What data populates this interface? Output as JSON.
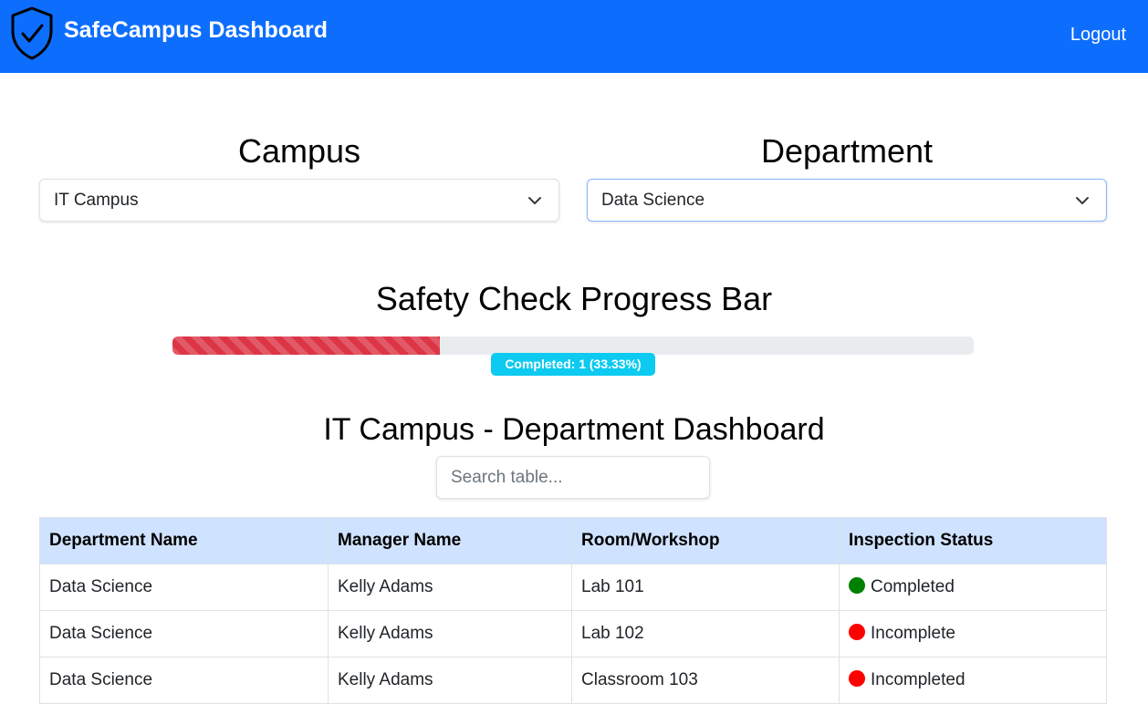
{
  "navbar": {
    "brand_title": "SafeCampus Dashboard",
    "logout_label": "Logout",
    "brand_icon": "shield-check-icon",
    "color": "#0d6efd"
  },
  "filters": {
    "campus_label": "Campus",
    "campus_value": "IT Campus",
    "department_label": "Department",
    "department_value": "Data Science"
  },
  "progress": {
    "title": "Safety Check Progress Bar",
    "completed_fraction": 0.3333,
    "badge_text": "Completed: 1 (33.33%)",
    "fill_color": "#dc3545",
    "badge_color": "#0dcaf0"
  },
  "dashboard": {
    "title": "IT Campus - Department Dashboard",
    "search_placeholder": "Search table..."
  },
  "table": {
    "headers": [
      "Department Name",
      "Manager Name",
      "Room/Workshop",
      "Inspection Status"
    ],
    "rows": [
      {
        "department": "Data Science",
        "manager": "Kelly Adams",
        "room": "Lab 101",
        "status": "Completed",
        "status_color": "#008000"
      },
      {
        "department": "Data Science",
        "manager": "Kelly Adams",
        "room": "Lab 102",
        "status": "Incomplete",
        "status_color": "#ff0000"
      },
      {
        "department": "Data Science",
        "manager": "Kelly Adams",
        "room": "Classroom 103",
        "status": "Incompleted",
        "status_color": "#ff0000"
      }
    ]
  }
}
